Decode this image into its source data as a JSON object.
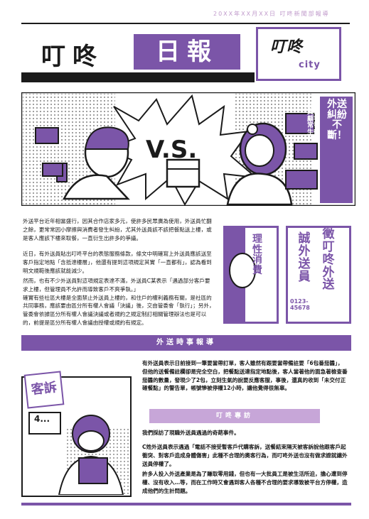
{
  "header": {
    "date": "20XX年XX月XX日 叮咚新聞部報導",
    "title_plain": "叮咚",
    "title_highlight": "日報",
    "logo_name": "叮咚",
    "logo_city": "city"
  },
  "hero": {
    "vs_text": "V.S.",
    "complaint_mark": "!?",
    "side_title": "外送糾紛不斷！",
    "side_subtitle": "外送員與顧客常發生衝突",
    "speech_1": "",
    "speech_2": ""
  },
  "article": {
    "p1": "外送平台近年相當盛行，因其合作店家多元，使許多民眾廣為使用，外送員忙翻之餘，更常常因小摩擦與消費者發生糾紛，尤其外送員該不該把餐點送上樓，或是客人應該下樓來取餐，一直衍生出許多的爭議。",
    "p2": "近日，有外送員貼出叮咚平台的表態服務條款，條文中明確寫上外送員應該送至客戶指定地點「含抵達樓層」，他還有提到這項規定其實「一直都有」，認為看到明文規範後應該就能減少。",
    "p3": "然而，也有不少外送員對這項規定表達不滿，外送員C某表示「遇過部分客戶要求上樓，但管理員不允許而導致客戶不爽爭執。」\n確實有些社區大樓是全面禁止外送員上樓的，和住戶的權利義務有關，是社區的共同事務，應該要由區分所有權人會議「決議」後，交由管委會「執行」；另外，管委會依據區分所有權人會議決議或者規約之規定制訂相關管理辦法也是可以的，前提是區分所有權人會議由授權或規約有規定。"
  },
  "side_panels": {
    "left_text": "理性消費",
    "right_col1": "誠外送員",
    "right_col2": "徵叮咚外送",
    "right_phone": "0123-45678"
  },
  "news": {
    "band_title": "外送時事報導",
    "body": "有外送員表示日前接到一筆要當帶訂單，客人雖然有跟要當帶備註要「6包番茄醬」，但他的送餐備註欄卻是完全空白，把餐點送達指定地點後，客人當著他的面急著檢查番茄醬的數量，發現少了2包，立刻生氣的說要反應客服，事後，還真的收到「未交付正確餐點」的警告單，帳號慘被停權12小時，讓他覺得很無辜。",
    "complaint_badge": "客訴",
    "phone_bubble": "4..."
  },
  "interview": {
    "band_title": "叮咚專訪",
    "lead": "我們採訪了現職外送員遇過的奇葩事件。",
    "p1": "C姓外送員表示遇過「電話不接受暫客戶代購客訴，送餐結束隔天被客訴說他跟客戶起衝突、對客戶造成身體傷害」此種不合理的奧客行為，而叮咚外送也沒有做求證就讓外送員停權了。",
    "p2": "許多人投入外送產業是為了賺取零用錢，但也有一大批員工是被生活所迫，擔心遭到停權、沒有收入…等，而在工作時又會遇到客人各種不合理的要求導致被平台方停權，造成他們的生計問題。"
  },
  "colors": {
    "accent": "#7b55a8",
    "accent_light": "#c7a6d8",
    "ink": "#1b1b1b"
  }
}
